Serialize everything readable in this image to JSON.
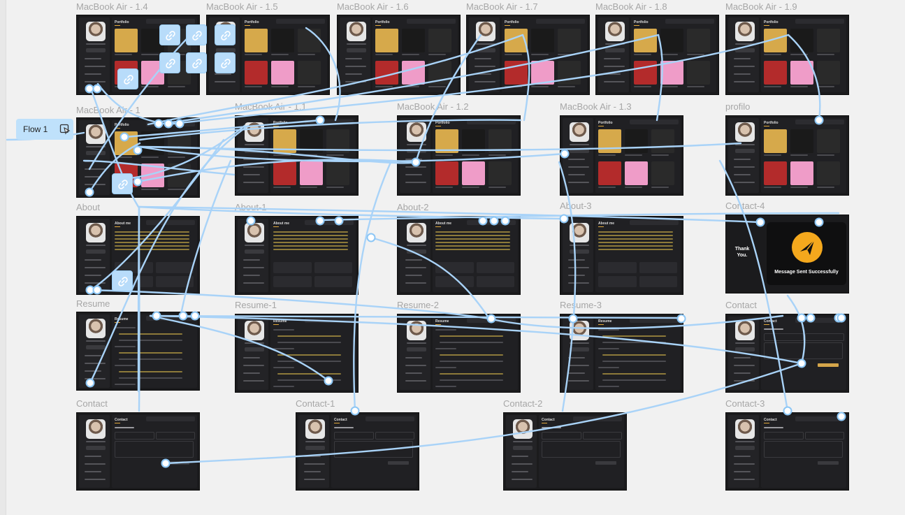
{
  "canvas": {
    "background": "#f1f1f1",
    "connector_color": "#a9d3f8",
    "accent": "#d4a54a"
  },
  "flow": {
    "label": "Flow 1",
    "icon": "play-flow-icon"
  },
  "frames": [
    {
      "id": "mba-1-4",
      "label": "MacBook Air - 1.4",
      "kind": "portfolio",
      "title": "Portfolio"
    },
    {
      "id": "mba-1-5",
      "label": "MacBook Air - 1.5",
      "kind": "portfolio",
      "title": "Portfolio"
    },
    {
      "id": "mba-1-6",
      "label": "MacBook Air - 1.6",
      "kind": "portfolio",
      "title": "Portfolio"
    },
    {
      "id": "mba-1-7",
      "label": "MacBook Air - 1.7",
      "kind": "portfolio",
      "title": "Portfolio"
    },
    {
      "id": "mba-1-8",
      "label": "MacBook Air - 1.8",
      "kind": "portfolio",
      "title": "Portfolio"
    },
    {
      "id": "mba-1-9",
      "label": "MacBook Air - 1.9",
      "kind": "portfolio",
      "title": "Portfolio"
    },
    {
      "id": "mba-1",
      "label": "MacBook Air - 1",
      "kind": "portfolio",
      "title": "Portfolio"
    },
    {
      "id": "mba-1-1",
      "label": "MacBook Air - 1.1",
      "kind": "portfolio",
      "title": "Portfolio"
    },
    {
      "id": "mba-1-2",
      "label": "MacBook Air - 1.2",
      "kind": "portfolio",
      "title": "Portfolio"
    },
    {
      "id": "mba-1-3",
      "label": "MacBook Air - 1.3",
      "kind": "portfolio",
      "title": "Portfolio"
    },
    {
      "id": "profilo",
      "label": "profilo",
      "kind": "portfolio",
      "title": "Portfolio"
    },
    {
      "id": "about",
      "label": "About",
      "kind": "about",
      "title": "About me"
    },
    {
      "id": "about-1",
      "label": "About-1",
      "kind": "about",
      "title": "About me"
    },
    {
      "id": "about-2",
      "label": "About-2",
      "kind": "about",
      "title": "About me"
    },
    {
      "id": "about-3",
      "label": "About-3",
      "kind": "about",
      "title": "About me"
    },
    {
      "id": "contact-4",
      "label": "Contact-4",
      "kind": "thanks",
      "title": "Thank You.",
      "message": "Message Sent Successfully"
    },
    {
      "id": "resume",
      "label": "Resume",
      "kind": "resume",
      "title": "Resume"
    },
    {
      "id": "resume-1",
      "label": "Resume-1",
      "kind": "resume",
      "title": "Resume"
    },
    {
      "id": "resume-2",
      "label": "Resume-2",
      "kind": "resume",
      "title": "Resume"
    },
    {
      "id": "resume-3",
      "label": "Resume-3",
      "kind": "resume",
      "title": "Resume"
    },
    {
      "id": "contact",
      "label": "Contact",
      "kind": "contact",
      "title": "Contact"
    },
    {
      "id": "contact-b",
      "label": "Contact",
      "kind": "contact",
      "title": "Contact"
    },
    {
      "id": "contact-1",
      "label": "Contact-1",
      "kind": "contact",
      "title": "Contact"
    },
    {
      "id": "contact-2",
      "label": "Contact-2",
      "kind": "contact",
      "title": "Contact"
    },
    {
      "id": "contact-3",
      "label": "Contact-3",
      "kind": "contact",
      "title": "Contact"
    }
  ]
}
